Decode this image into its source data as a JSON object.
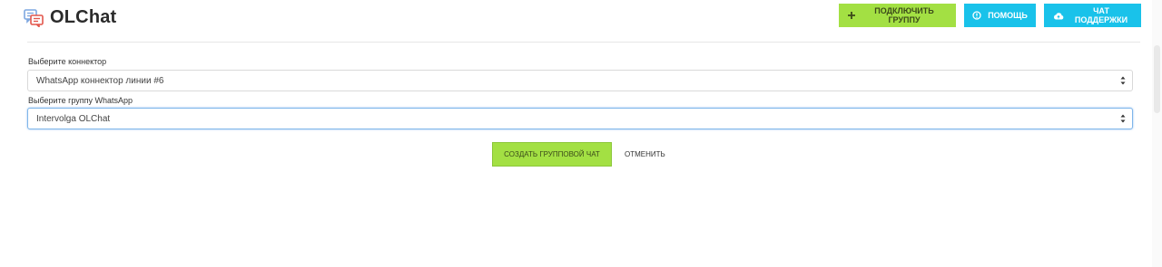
{
  "app": {
    "title": "OLChat",
    "logo_icon": "chat-bubbles-icon"
  },
  "toolbar": {
    "connect_group_label": "ПОДКЛЮЧИТЬ ГРУППУ",
    "help_label": "ПОМОЩЬ",
    "support_chat_label": "ЧАТ ПОДДЕРЖКИ"
  },
  "form": {
    "connector_label": "Выберите коннектор",
    "connector_value": "WhatsApp коннектор линии #6",
    "group_label": "Выберите группу WhatsApp",
    "group_value": "Intervolga OLChat",
    "create_button": "СОЗДАТЬ ГРУППОВОЙ ЧАТ",
    "cancel_button": "ОТМЕНИТЬ"
  },
  "colors": {
    "green_button": "#a3e043",
    "cyan_button": "#19c2ea",
    "logo_blue": "#7da7e0",
    "logo_red": "#e3574c"
  }
}
